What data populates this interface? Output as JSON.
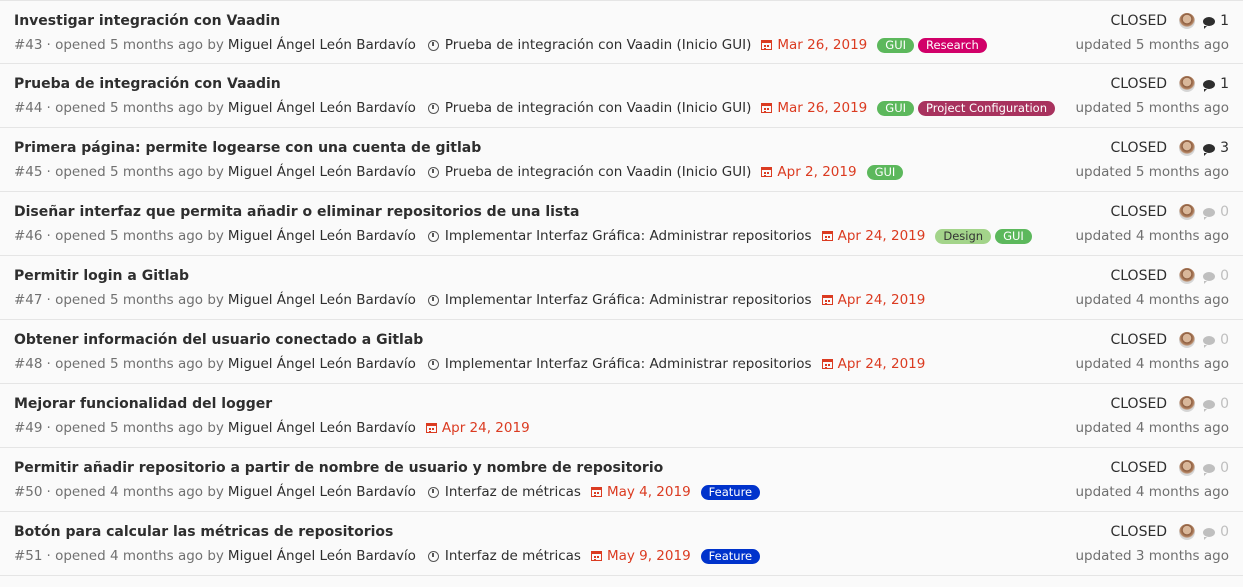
{
  "colors": {
    "GUI": "#5cb85c",
    "Research": "#d10069",
    "Project Configuration": "#a8325e",
    "Design": "#a3d48a",
    "Feature": "#0033cc"
  },
  "issues": [
    {
      "title": "Investigar integración con Vaadin",
      "ref": "#43",
      "opened": "· opened 5 months ago by",
      "author": "Miguel Ángel León Bardavío",
      "milestone": "Prueba de integración con Vaadin (Inicio GUI)",
      "due": "Mar 26, 2019",
      "labels": [
        "GUI",
        "Research"
      ],
      "status": "CLOSED",
      "comments": "1",
      "updated": "updated 5 months ago"
    },
    {
      "title": "Prueba de integración con Vaadin",
      "ref": "#44",
      "opened": "· opened 5 months ago by",
      "author": "Miguel Ángel León Bardavío",
      "milestone": "Prueba de integración con Vaadin (Inicio GUI)",
      "due": "Mar 26, 2019",
      "labels": [
        "GUI",
        "Project Configuration"
      ],
      "status": "CLOSED",
      "comments": "1",
      "updated": "updated 5 months ago"
    },
    {
      "title": "Primera página: permite logearse con una cuenta de gitlab",
      "ref": "#45",
      "opened": "· opened 5 months ago by",
      "author": "Miguel Ángel León Bardavío",
      "milestone": "Prueba de integración con Vaadin (Inicio GUI)",
      "due": "Apr 2, 2019",
      "labels": [
        "GUI"
      ],
      "status": "CLOSED",
      "comments": "3",
      "updated": "updated 5 months ago"
    },
    {
      "title": "Diseñar interfaz que permita añadir o eliminar repositorios de una lista",
      "ref": "#46",
      "opened": "· opened 5 months ago by",
      "author": "Miguel Ángel León Bardavío",
      "milestone": "Implementar Interfaz Gráfica: Administrar repositorios",
      "due": "Apr 24, 2019",
      "labels": [
        "Design",
        "GUI"
      ],
      "status": "CLOSED",
      "comments": "0",
      "updated": "updated 4 months ago"
    },
    {
      "title": "Permitir login a Gitlab",
      "ref": "#47",
      "opened": "· opened 5 months ago by",
      "author": "Miguel Ángel León Bardavío",
      "milestone": "Implementar Interfaz Gráfica: Administrar repositorios",
      "due": "Apr 24, 2019",
      "labels": [],
      "status": "CLOSED",
      "comments": "0",
      "updated": "updated 4 months ago"
    },
    {
      "title": "Obtener información del usuario conectado a Gitlab",
      "ref": "#48",
      "opened": "· opened 5 months ago by",
      "author": "Miguel Ángel León Bardavío",
      "milestone": "Implementar Interfaz Gráfica: Administrar repositorios",
      "due": "Apr 24, 2019",
      "labels": [],
      "status": "CLOSED",
      "comments": "0",
      "updated": "updated 4 months ago"
    },
    {
      "title": "Mejorar funcionalidad del logger",
      "ref": "#49",
      "opened": "· opened 5 months ago by",
      "author": "Miguel Ángel León Bardavío",
      "milestone": "",
      "due": "Apr 24, 2019",
      "labels": [],
      "status": "CLOSED",
      "comments": "0",
      "updated": "updated 4 months ago"
    },
    {
      "title": "Permitir añadir repositorio a partir de nombre de usuario y nombre de repositorio",
      "ref": "#50",
      "opened": "· opened 4 months ago by",
      "author": "Miguel Ángel León Bardavío",
      "milestone": "Interfaz de métricas",
      "due": "May 4, 2019",
      "labels": [
        "Feature"
      ],
      "status": "CLOSED",
      "comments": "0",
      "updated": "updated 4 months ago"
    },
    {
      "title": "Botón para calcular las métricas de repositorios",
      "ref": "#51",
      "opened": "· opened 4 months ago by",
      "author": "Miguel Ángel León Bardavío",
      "milestone": "Interfaz de métricas",
      "due": "May 9, 2019",
      "labels": [
        "Feature"
      ],
      "status": "CLOSED",
      "comments": "0",
      "updated": "updated 3 months ago"
    }
  ]
}
